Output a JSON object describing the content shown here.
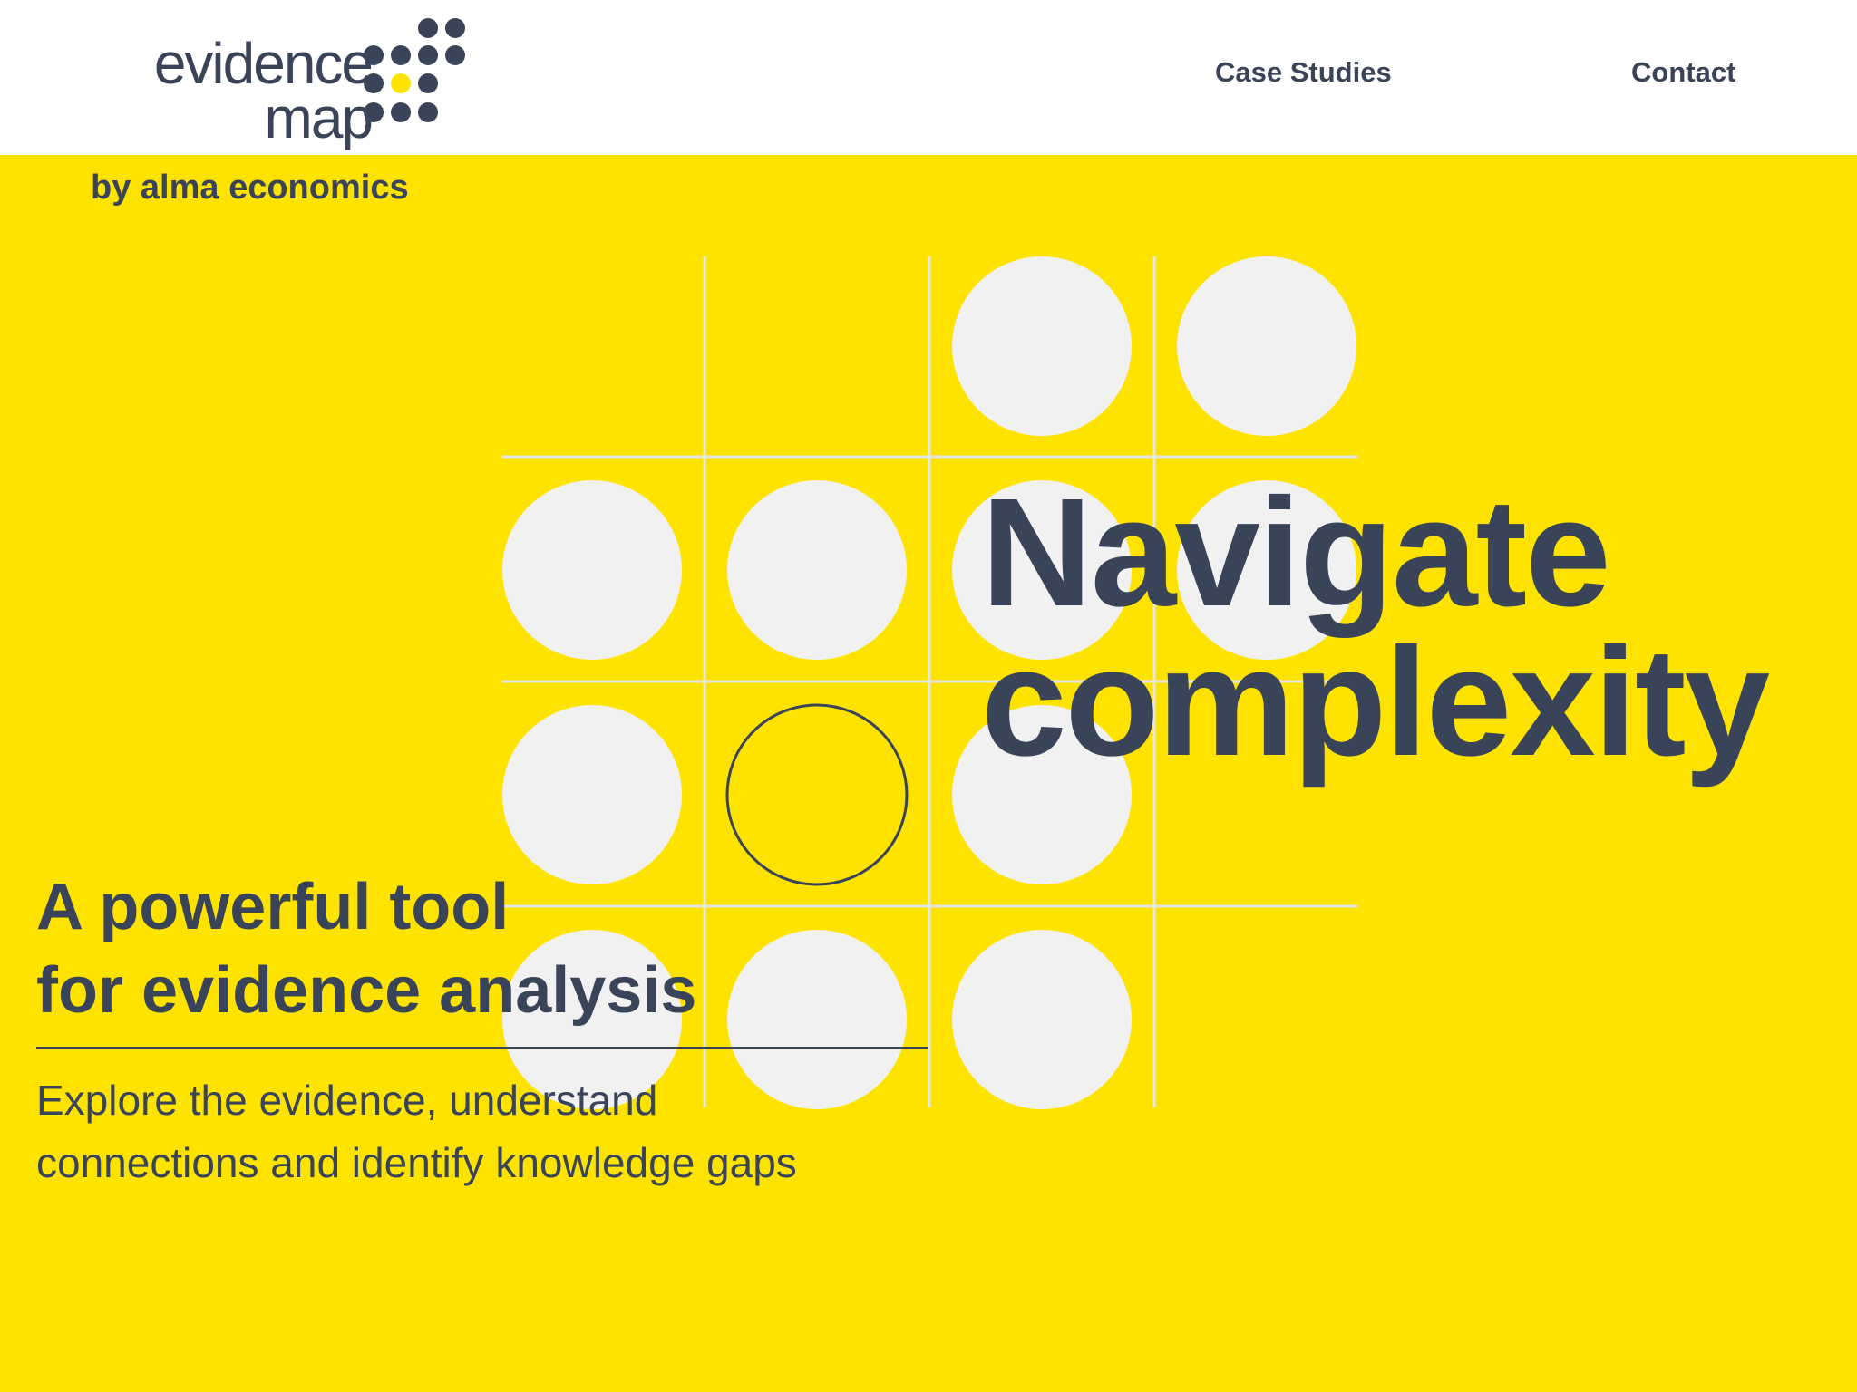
{
  "header": {
    "logo": {
      "line1": "evidence",
      "line2": "map",
      "accent_color": "#FFE300",
      "dot_color": "#3A4458"
    },
    "nav": [
      {
        "label": "Case Studies"
      },
      {
        "label": "Contact"
      }
    ]
  },
  "byline": "by alma economics",
  "hero": {
    "title_line1": "Navigate",
    "title_line2": "complexity",
    "subhead_line1": "A powerful tool",
    "subhead_line2": "for evidence analysis",
    "description_line1": "Explore the evidence, understand",
    "description_line2": "connections and identify knowledge gaps"
  },
  "colors": {
    "background": "#FFE300",
    "header_bg": "#FFFFFF",
    "text": "#3A4458",
    "circle_fill": "#F1F1F1",
    "grid_line": "#E6E6E6"
  }
}
